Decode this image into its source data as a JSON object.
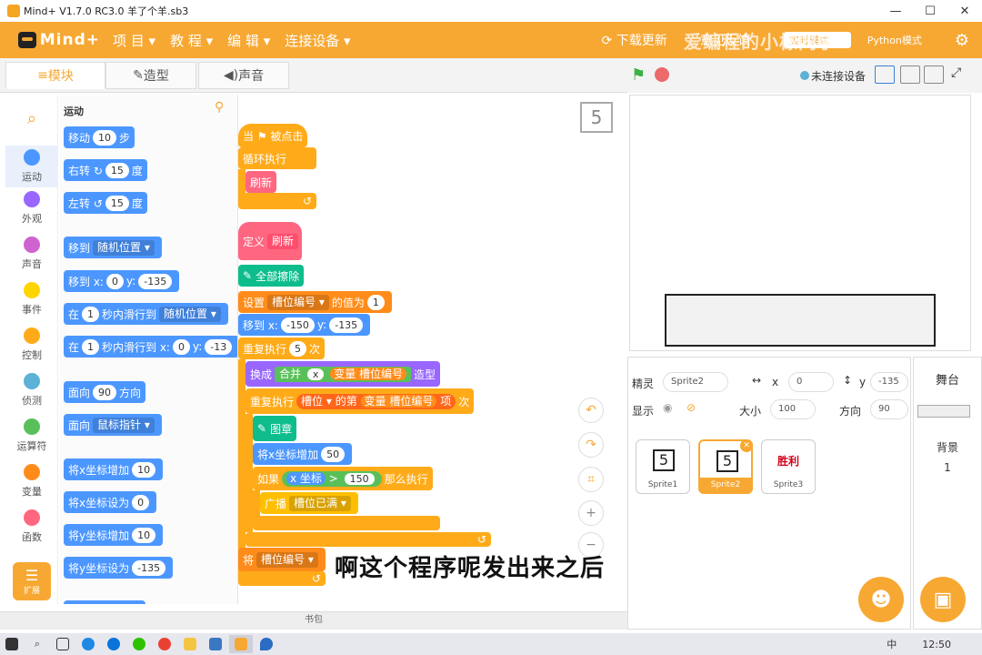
{
  "window": {
    "title": "Mind+ V1.7.0 RC3.0   羊了个羊.sb3"
  },
  "menubar": {
    "brand": "Mind+",
    "items": [
      "项 目 ▾",
      "教 程 ▾",
      "编 辑 ▾",
      "连接设备 ▾"
    ],
    "right": [
      "下载更新",
      "意见反馈",
      "实时模式",
      "Python模式"
    ]
  },
  "tabs": {
    "blocks": "模块",
    "costumes": "造型",
    "sounds": "声音"
  },
  "categories": [
    "运动",
    "外观",
    "声音",
    "事件",
    "控制",
    "侦测",
    "运算符",
    "变量",
    "函数"
  ],
  "category_colors": [
    "#4c97ff",
    "#9966ff",
    "#cf63cf",
    "#ffd500",
    "#ffab19",
    "#5cb1d6",
    "#59c059",
    "#ff8c1a",
    "#ff6680"
  ],
  "extensions_label": "扩展",
  "palette": {
    "heading": "运动",
    "move": {
      "a": "移动",
      "n": "10",
      "b": "步"
    },
    "turn_right": {
      "a": "右转 ↻",
      "n": "15",
      "b": "度"
    },
    "turn_left": {
      "a": "左转 ↺",
      "n": "15",
      "b": "度"
    },
    "goto": {
      "a": "移到",
      "dd": "随机位置 ▾"
    },
    "goto_xy": {
      "a": "移到 x:",
      "x": "0",
      "b": "y:",
      "y": "-135"
    },
    "glide_random": {
      "a": "在",
      "n": "1",
      "b": "秒内滑行到",
      "dd": "随机位置 ▾"
    },
    "glide_xy": {
      "a": "在",
      "n": "1",
      "b": "秒内滑行到 x:",
      "x": "0",
      "c": "y:",
      "y": "-13"
    },
    "point_dir": {
      "a": "面向",
      "n": "90",
      "b": "方向"
    },
    "point_towards": {
      "a": "面向",
      "dd": "鼠标指针 ▾"
    },
    "change_x": {
      "a": "将x坐标增加",
      "n": "10"
    },
    "set_x": {
      "a": "将x坐标设为",
      "n": "0"
    },
    "change_y": {
      "a": "将y坐标增加",
      "n": "10"
    },
    "set_y": {
      "a": "将y坐标设为",
      "n": "-135"
    }
  },
  "script": {
    "when_flag": "当 ⚑ 被点击",
    "forever": "循环执行",
    "refresh_call": "刷新",
    "define": "定义",
    "define_name": "刷新",
    "clear": "全部擦除",
    "set_var": {
      "a": "设置",
      "dd": "槽位编号 ▾",
      "b": "的值为",
      "n": "1"
    },
    "goto_xy": {
      "a": "移到 x:",
      "x": "-150",
      "b": "y:",
      "y": "-135"
    },
    "repeat": {
      "a": "重复执行",
      "n": "5",
      "b": "次"
    },
    "switch_costume": {
      "a": "换成",
      "join": "合并",
      "x": "x",
      "var": "变量 槽位编号",
      "b": "造型"
    },
    "repeat_item": {
      "a": "重复执行",
      "list": "槽位 ▾",
      "b": "的第",
      "var": "变量 槽位编号",
      "c": "项",
      "d": "次"
    },
    "stamp": "图章",
    "change_x": {
      "a": "将x坐标增加",
      "n": "50"
    },
    "if": {
      "a": "如果",
      "x": "x 坐标",
      "op": ">",
      "n": "150",
      "b": "那么执行"
    },
    "broadcast": {
      "a": "广播",
      "dd": "槽位已满 ▾"
    },
    "last": {
      "a": "将",
      "dd": "槽位编号 ▾"
    },
    "stage_number": "5"
  },
  "caption": "啊这个程序呢发出来之后",
  "bag_label": "书包",
  "watermark": "爱编程的小栋同学",
  "stage_controls": {
    "status": "未连接设备"
  },
  "sprite_info": {
    "sprite_label": "精灵",
    "sprite_name": "Sprite2",
    "x_label": "x",
    "x": "0",
    "y_label": "y",
    "y": "-135",
    "show_label": "显示",
    "size_label": "大小",
    "size": "100",
    "dir_label": "方向",
    "dir": "90"
  },
  "sprites": [
    {
      "name": "Sprite1",
      "thumb": "5"
    },
    {
      "name": "Sprite2",
      "thumb": "5"
    },
    {
      "name": "Sprite3",
      "thumb": "胜利"
    }
  ],
  "backdrop": {
    "label": "舞台",
    "bg_label": "背景",
    "count": "1"
  },
  "taskbar": {
    "time": "12:50",
    "lang": "中"
  }
}
